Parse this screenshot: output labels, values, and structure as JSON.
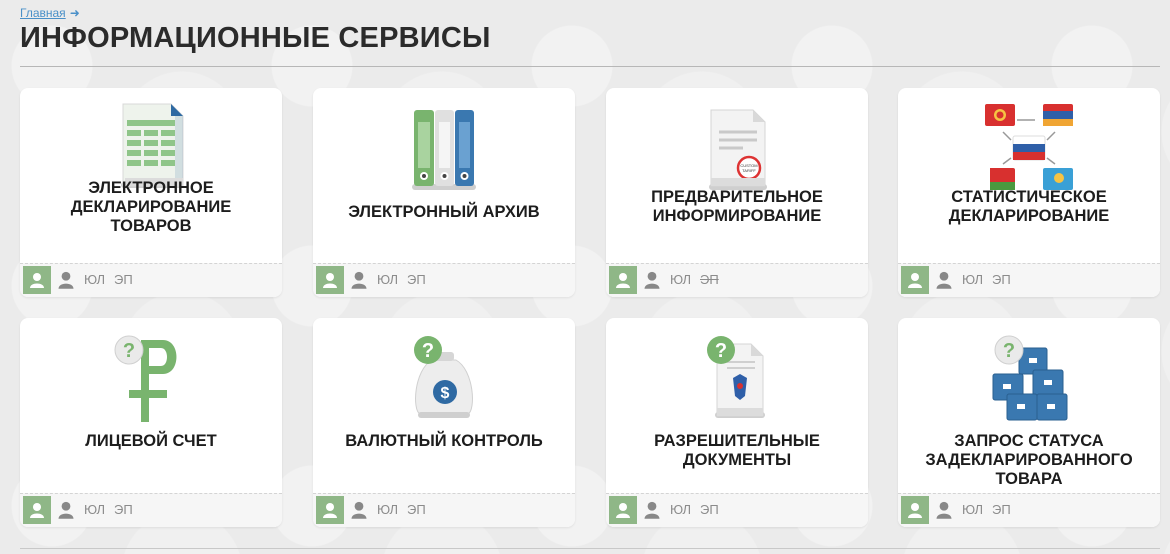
{
  "breadcrumb": {
    "home": "Главная",
    "arrow": "➜"
  },
  "page_title": "ИНФОРМАЦИОННЫЕ СЕРВИСЫ",
  "cards": [
    {
      "title": "ЭЛЕКТРОННОЕ ДЕКЛАРИРОВАНИЕ ТОВАРОВ",
      "icon": "spreadsheet-document-icon",
      "tag_yl": "ЮЛ",
      "tag_ep": "ЭП",
      "ep_disabled": false
    },
    {
      "title": "ЭЛЕКТРОННЫЙ АРХИВ",
      "icon": "binders-icon",
      "tag_yl": "ЮЛ",
      "tag_ep": "ЭП",
      "ep_disabled": false
    },
    {
      "title": "ПРЕДВАРИТЕЛЬНОЕ ИНФОРМИРОВАНИЕ",
      "icon": "customs-document-icon",
      "stamp": "CUSTOM TARIFF",
      "tag_yl": "ЮЛ",
      "tag_ep": "ЭП",
      "ep_disabled": true
    },
    {
      "title": "СТАТИСТИЧЕСКОЕ ДЕКЛАРИРОВАНИЕ",
      "icon": "flags-exchange-icon",
      "tag_yl": "ЮЛ",
      "tag_ep": "ЭП",
      "ep_disabled": false
    },
    {
      "title": "ЛИЦЕВОЙ СЧЕТ",
      "icon": "ruble-question-icon",
      "tag_yl": "ЮЛ",
      "tag_ep": "ЭП",
      "ep_disabled": false
    },
    {
      "title": "ВАЛЮТНЫЙ КОНТРОЛЬ",
      "icon": "money-bag-question-icon",
      "bag_symbol": "$",
      "tag_yl": "ЮЛ",
      "tag_ep": "ЭП",
      "ep_disabled": false
    },
    {
      "title": "РАЗРЕШИТЕЛЬНЫЕ ДОКУМЕНТЫ",
      "icon": "permit-document-question-icon",
      "tag_yl": "ЮЛ",
      "tag_ep": "ЭП",
      "ep_disabled": false
    },
    {
      "title": "ЗАПРОС СТАТУСА ЗАДЕКЛАРИРОВАННОГО ТОВАРА",
      "icon": "boxes-question-icon",
      "tag_yl": "ЮЛ",
      "tag_ep": "ЭП",
      "ep_disabled": false
    }
  ],
  "question_mark": "?",
  "colors": {
    "green": "#8fb787",
    "blue": "#3a78b0",
    "title": "#1d1d1d",
    "tag": "#8b8b8b",
    "link": "#4a90c8"
  }
}
